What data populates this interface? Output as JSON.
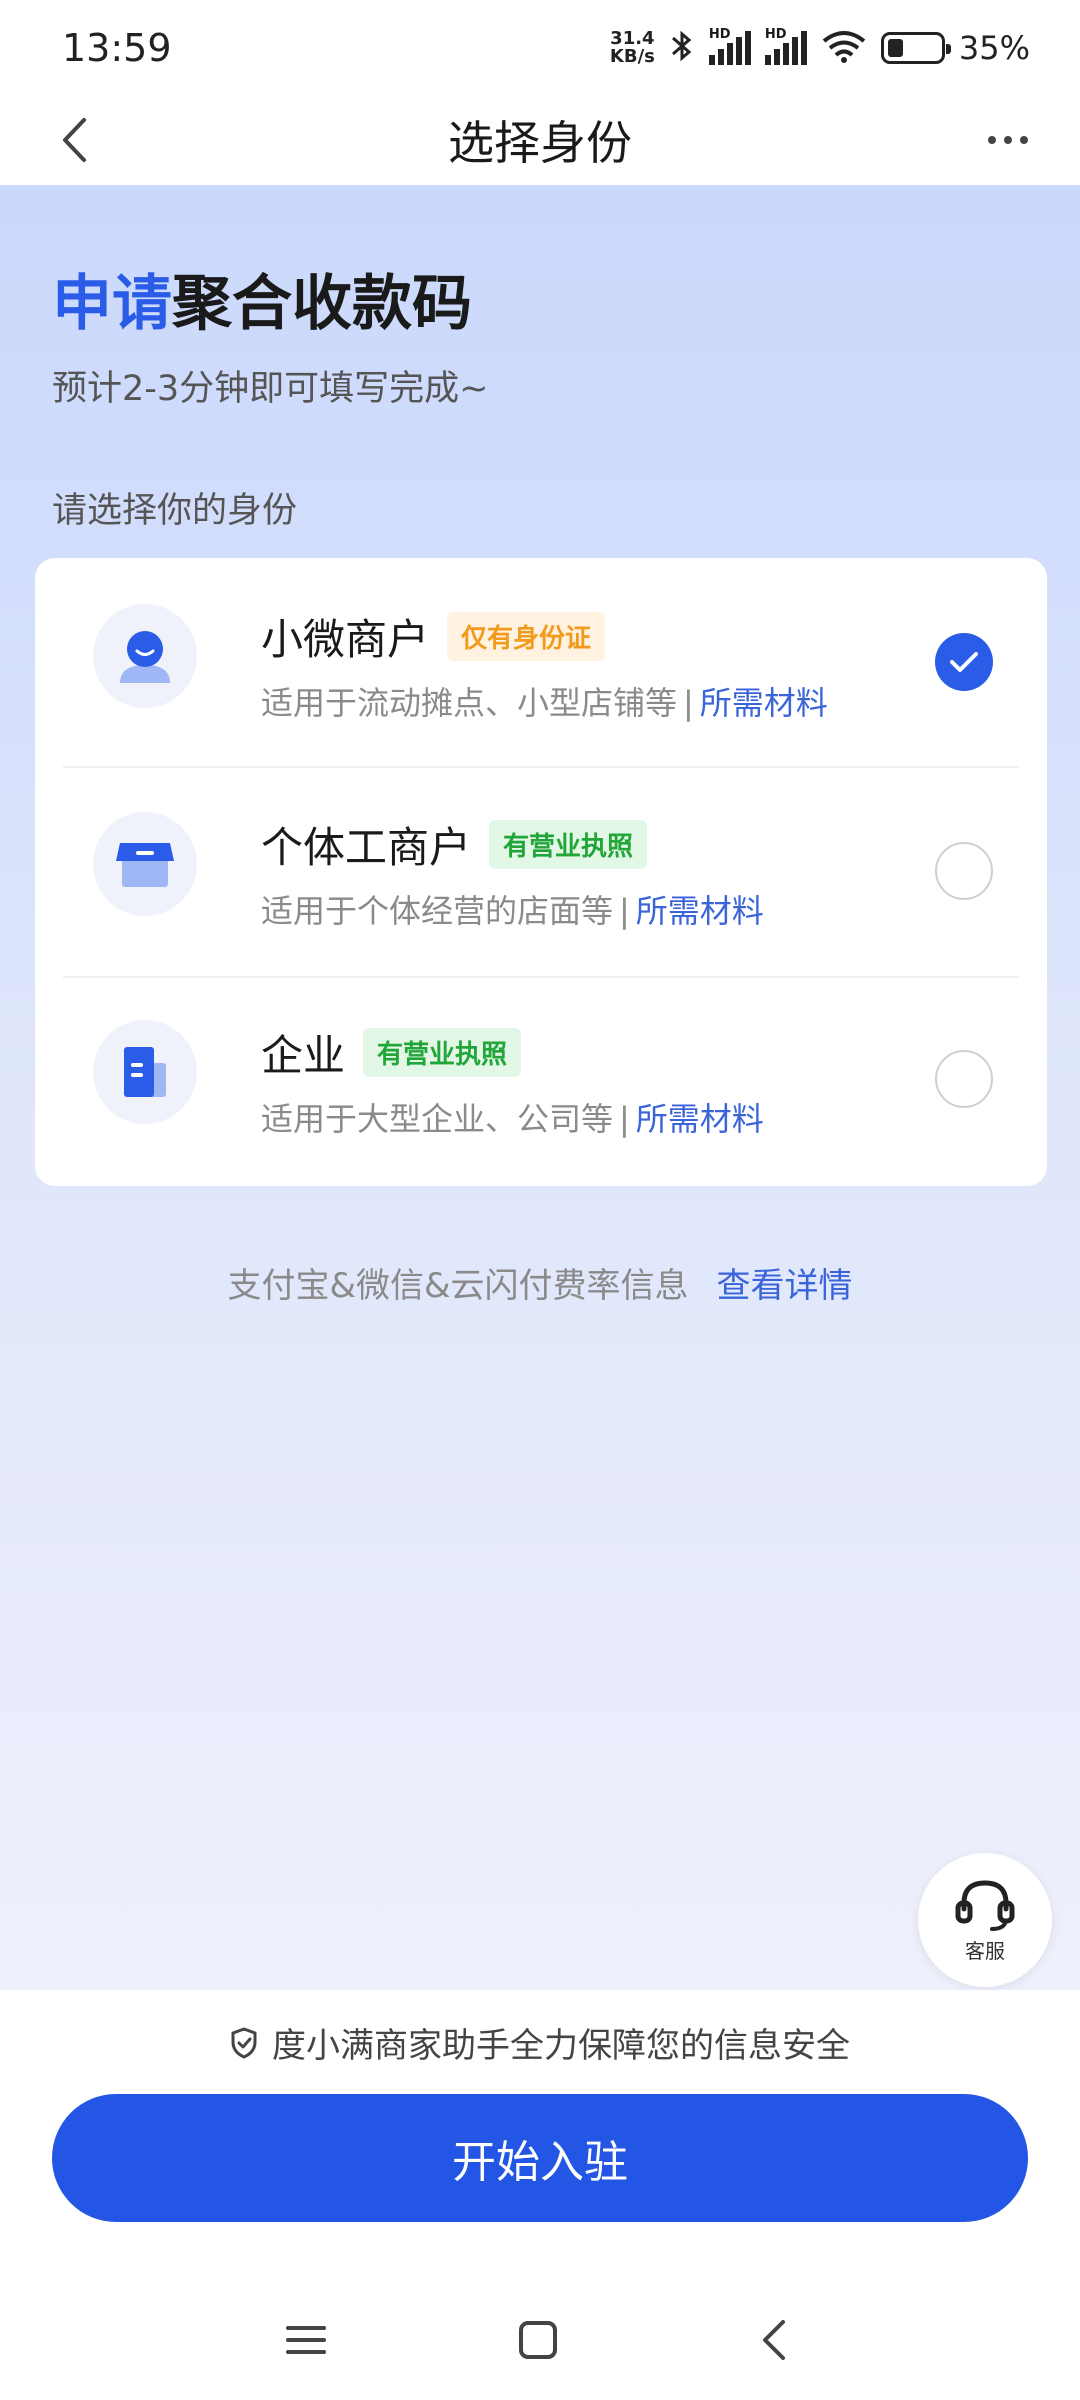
{
  "status_bar": {
    "time": "13:59",
    "net_speed_top": "31.4",
    "net_speed_bottom": "KB/s",
    "signal_label": "HD",
    "battery_level": 0.35,
    "battery_pct": "35%"
  },
  "nav": {
    "title": "选择身份",
    "back_icon": "chevron-left-icon",
    "more_icon": "more-horizontal-icon"
  },
  "header": {
    "headline_accent": "申请",
    "headline_rest": "聚合收款码",
    "subtitle": "预计2-3分钟即可填写完成~",
    "section_label": "请选择你的身份"
  },
  "options": [
    {
      "title": "小微商户",
      "badge": "仅有身份证",
      "desc": "适用于流动摊点、小型店铺等",
      "separator": "|",
      "link": "所需材料",
      "icon": "person-icon",
      "selected": true
    },
    {
      "title": "个体工商户",
      "badge": "有营业执照",
      "desc": "适用于个体经营的店面等",
      "separator": "|",
      "link": "所需材料",
      "icon": "shop-icon",
      "selected": false
    },
    {
      "title": "企业",
      "badge": "有营业执照",
      "desc": "适用于大型企业、公司等",
      "separator": "|",
      "link": "所需材料",
      "icon": "building-icon",
      "selected": false
    }
  ],
  "rate_info": {
    "text": "支付宝&微信&云闪付费率信息",
    "link": "查看详情"
  },
  "customer_service": {
    "label": "客服",
    "icon": "headset-icon"
  },
  "footer": {
    "security_text": "度小满商家助手全力保障您的信息安全",
    "security_icon": "shield-check-icon",
    "start_button": "开始入驻"
  },
  "colors": {
    "accent": "#2a5ce8",
    "button": "#2456e6",
    "badge_orange": "#f29a1c",
    "badge_green": "#22a63a",
    "link": "#3a64d9"
  }
}
